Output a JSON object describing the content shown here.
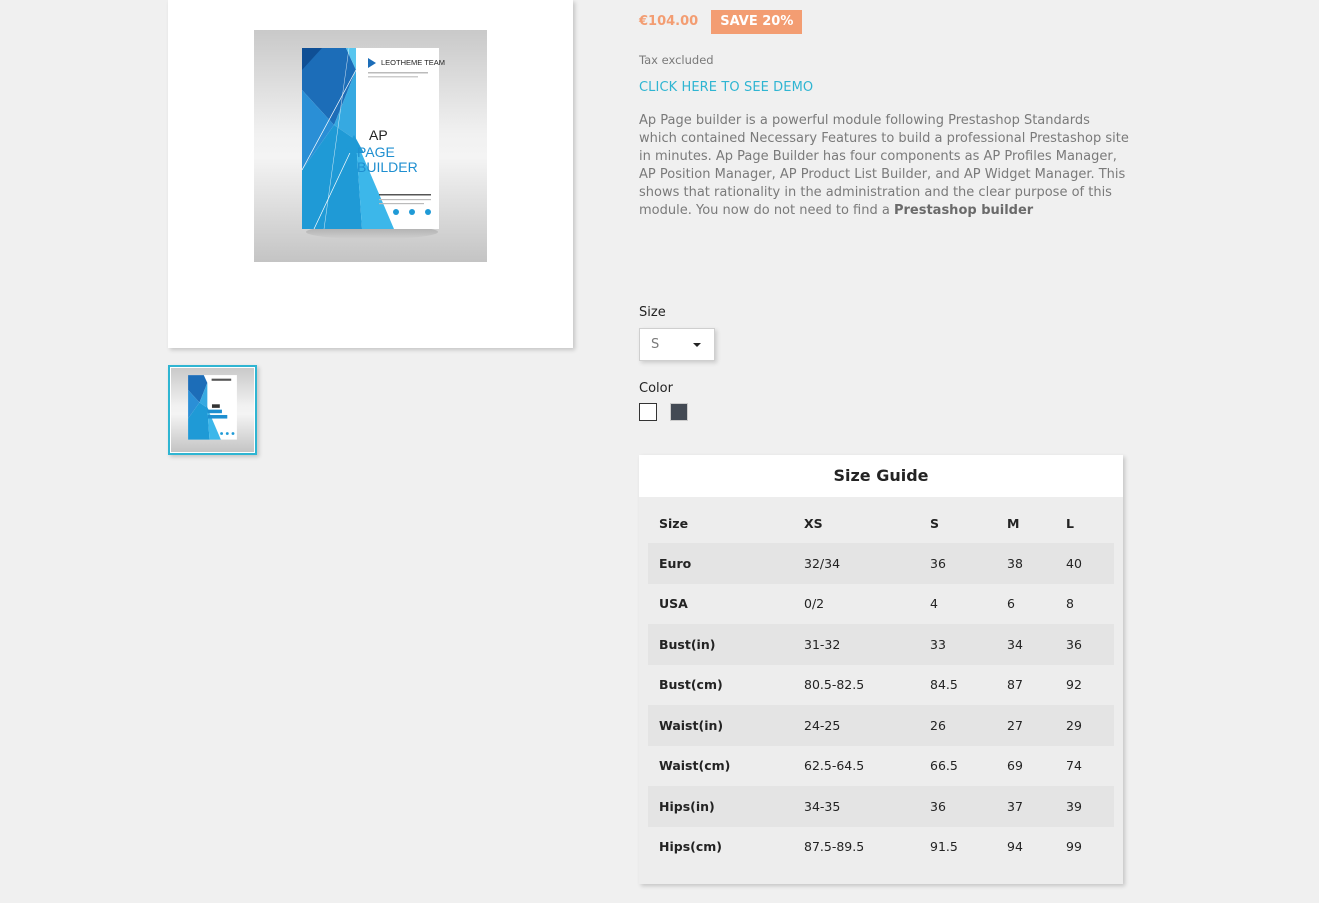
{
  "product": {
    "price": "€104.00",
    "discount": "SAVE 20%",
    "tax_note": "Tax excluded",
    "demo_link": "CLICK HERE TO SEE DEMO",
    "description_text": "Ap Page builder is a powerful module following Prestashop Standards which contained Necessary Features to build a professional Prestashop site in minutes. Ap Page Builder has four components as AP Profiles Manager, AP Position Manager, AP Product List Builder, and AP Widget Manager. This shows that rationality in the administration and the clear purpose of this module. You now do not need to find a ",
    "description_bold": "Prestashop builder",
    "cover": {
      "brand": "LEOTHEME TEAM",
      "line1": "AP",
      "line2": "PAGE",
      "line3": "BUILDER"
    }
  },
  "variants": {
    "size_label": "Size",
    "size_selected": "S",
    "color_label": "Color",
    "colors": [
      "#ffffff",
      "#434a54"
    ]
  },
  "size_guide": {
    "title": "Size Guide",
    "headers": [
      "Size",
      "XS",
      "S",
      "M",
      "L"
    ],
    "rows": [
      [
        "Euro",
        "32/34",
        "36",
        "38",
        "40"
      ],
      [
        "USA",
        "0/2",
        "4",
        "6",
        "8"
      ],
      [
        "Bust(in)",
        "31-32",
        "33",
        "34",
        "36"
      ],
      [
        "Bust(cm)",
        "80.5-82.5",
        "84.5",
        "87",
        "92"
      ],
      [
        "Waist(in)",
        "24-25",
        "26",
        "27",
        "29"
      ],
      [
        "Waist(cm)",
        "62.5-64.5",
        "66.5",
        "69",
        "74"
      ],
      [
        "Hips(in)",
        "34-35",
        "36",
        "37",
        "39"
      ],
      [
        "Hips(cm)",
        "87.5-89.5",
        "91.5",
        "94",
        "99"
      ]
    ]
  },
  "colors": {
    "accent": "#2fb5d2",
    "price": "#f39d72"
  }
}
